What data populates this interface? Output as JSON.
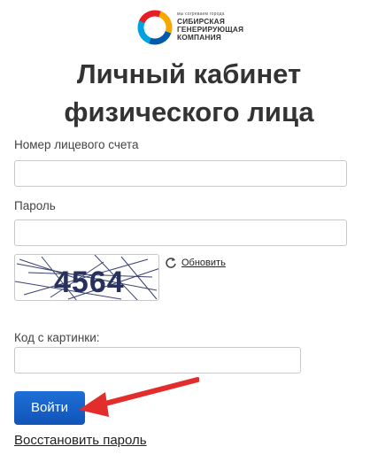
{
  "logo": {
    "tagline": "мы согреваем города",
    "name_lines": [
      "СИБИРСКАЯ",
      "ГЕНЕРИРУЮЩАЯ",
      "КОМПАНИЯ"
    ]
  },
  "title_lines": [
    "Личный кабинет",
    "физического лица"
  ],
  "form": {
    "account_label": "Номер лицевого счета",
    "account_value": "",
    "password_label": "Пароль",
    "password_value": "",
    "captcha_text": "4564",
    "refresh_label": "Обновить",
    "captcha_code_label": "Код с картинки:",
    "captcha_code_value": "",
    "submit_label": "Войти",
    "restore_label": "Восстановить пароль"
  },
  "colors": {
    "primary_button": "#1560c6",
    "annotation_arrow": "#e32c2c",
    "logo_ring": [
      "#e31e24",
      "#f6a800",
      "#005bab",
      "#00a3e0"
    ]
  },
  "icons": {
    "refresh": "refresh-icon",
    "arrow": "annotation-arrow"
  }
}
